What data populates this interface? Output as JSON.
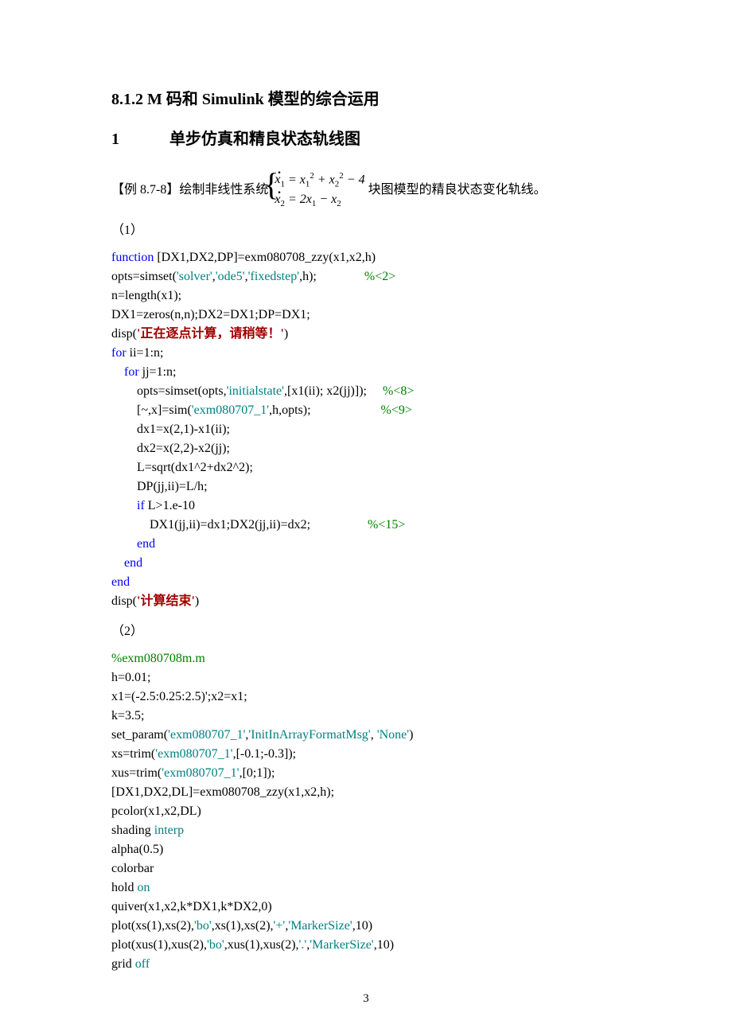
{
  "headings": {
    "section": "8.1.2  M 码和 Simulink 模型的综合运用",
    "sub_num": "1",
    "sub_title": "单步仿真和精良状态轨线图"
  },
  "example": {
    "label": "【例 8.7-8】",
    "pre": "绘制非线性系统",
    "post": "块图模型的精良状态变化轨线。"
  },
  "parts": {
    "p1": "（1）",
    "p2": "（2）"
  },
  "code1": [
    {
      "t": "function",
      "c": "blue"
    },
    {
      "t": " [DX1,DX2,DP]=exm080708_zzy(x1,x2,h)  ",
      "c": ""
    },
    {
      "nl": 1
    },
    {
      "t": "opts=simset(",
      "c": ""
    },
    {
      "t": "'solver'",
      "c": "teal"
    },
    {
      "t": ",",
      "c": ""
    },
    {
      "t": "'ode5'",
      "c": "teal"
    },
    {
      "t": ",",
      "c": ""
    },
    {
      "t": "'fixedstep'",
      "c": "teal"
    },
    {
      "t": ",h);               ",
      "c": ""
    },
    {
      "t": "%<2>",
      "c": "green"
    },
    {
      "nl": 1
    },
    {
      "t": "n=length(x1);",
      "c": ""
    },
    {
      "nl": 1
    },
    {
      "t": "DX1=zeros(n,n);DX2=DX1;DP=DX1;",
      "c": ""
    },
    {
      "nl": 1
    },
    {
      "t": "disp(",
      "c": ""
    },
    {
      "t": "'正在逐点计算，请稍等！'",
      "c": "red"
    },
    {
      "t": ")",
      "c": ""
    },
    {
      "nl": 1
    },
    {
      "t": "for",
      "c": "blue"
    },
    {
      "t": " ii=1:n;",
      "c": ""
    },
    {
      "nl": 1
    },
    {
      "t": "    ",
      "c": ""
    },
    {
      "t": "for",
      "c": "blue"
    },
    {
      "t": " jj=1:n;",
      "c": ""
    },
    {
      "nl": 1
    },
    {
      "t": "        opts=simset(opts,",
      "c": ""
    },
    {
      "t": "'initialstate'",
      "c": "teal"
    },
    {
      "t": ",[x1(ii); x2(jj)]);     ",
      "c": ""
    },
    {
      "t": "%<8>",
      "c": "green"
    },
    {
      "nl": 1
    },
    {
      "t": "        [~,x]=sim(",
      "c": ""
    },
    {
      "t": "'exm080707_1'",
      "c": "teal"
    },
    {
      "t": ",h,opts);                      ",
      "c": ""
    },
    {
      "t": "%<9>",
      "c": "green"
    },
    {
      "nl": 1
    },
    {
      "t": "        dx1=x(2,1)-x1(ii);",
      "c": ""
    },
    {
      "nl": 1
    },
    {
      "t": "        dx2=x(2,2)-x2(jj);",
      "c": ""
    },
    {
      "nl": 1
    },
    {
      "t": "        L=sqrt(dx1^2+dx2^2);",
      "c": ""
    },
    {
      "nl": 1
    },
    {
      "t": "        DP(jj,ii)=L/h;",
      "c": ""
    },
    {
      "nl": 1
    },
    {
      "t": "        ",
      "c": ""
    },
    {
      "t": "if",
      "c": "blue"
    },
    {
      "t": " L>1.e-10",
      "c": ""
    },
    {
      "nl": 1
    },
    {
      "t": "            DX1(jj,ii)=dx1;DX2(jj,ii)=dx2;                  ",
      "c": ""
    },
    {
      "t": "%<15>",
      "c": "green"
    },
    {
      "nl": 1
    },
    {
      "t": "        ",
      "c": ""
    },
    {
      "t": "end",
      "c": "blue"
    },
    {
      "nl": 1
    },
    {
      "t": "    ",
      "c": ""
    },
    {
      "t": "end",
      "c": "blue"
    },
    {
      "nl": 1
    },
    {
      "t": "end",
      "c": "blue"
    },
    {
      "nl": 1
    },
    {
      "t": "disp(",
      "c": ""
    },
    {
      "t": "'计算结束'",
      "c": "red"
    },
    {
      "t": ")",
      "c": ""
    },
    {
      "nl": 1
    }
  ],
  "code2": [
    {
      "t": "%exm080708m.m",
      "c": "green"
    },
    {
      "nl": 1
    },
    {
      "t": "h=0.01;",
      "c": ""
    },
    {
      "nl": 1
    },
    {
      "t": "x1=(-2.5:0.25:2.5)';x2=x1;",
      "c": ""
    },
    {
      "nl": 1
    },
    {
      "t": "k=3.5;",
      "c": ""
    },
    {
      "nl": 1
    },
    {
      "t": "set_param(",
      "c": ""
    },
    {
      "t": "'exm080707_1'",
      "c": "teal"
    },
    {
      "t": ",",
      "c": ""
    },
    {
      "t": "'InitInArrayFormatMsg'",
      "c": "teal"
    },
    {
      "t": ", ",
      "c": ""
    },
    {
      "t": "'None'",
      "c": "teal"
    },
    {
      "t": ")",
      "c": ""
    },
    {
      "nl": 1
    },
    {
      "t": "xs=trim(",
      "c": ""
    },
    {
      "t": "'exm080707_1'",
      "c": "teal"
    },
    {
      "t": ",[-0.1;-0.3]);",
      "c": ""
    },
    {
      "nl": 1
    },
    {
      "t": "xus=trim(",
      "c": ""
    },
    {
      "t": "'exm080707_1'",
      "c": "teal"
    },
    {
      "t": ",[0;1]);",
      "c": ""
    },
    {
      "nl": 1
    },
    {
      "t": "[DX1,DX2,DL]=exm080708_zzy(x1,x2,h);",
      "c": ""
    },
    {
      "nl": 1
    },
    {
      "t": "pcolor(x1,x2,DL)",
      "c": ""
    },
    {
      "nl": 1
    },
    {
      "t": "shading ",
      "c": ""
    },
    {
      "t": "interp",
      "c": "teal"
    },
    {
      "nl": 1
    },
    {
      "t": "alpha(0.5)",
      "c": ""
    },
    {
      "nl": 1
    },
    {
      "t": "colorbar",
      "c": ""
    },
    {
      "nl": 1
    },
    {
      "t": "hold ",
      "c": ""
    },
    {
      "t": "on",
      "c": "teal"
    },
    {
      "nl": 1
    },
    {
      "t": "quiver(x1,x2,k*DX1,k*DX2,0)",
      "c": ""
    },
    {
      "nl": 1
    },
    {
      "t": "plot(xs(1),xs(2),",
      "c": ""
    },
    {
      "t": "'bo'",
      "c": "teal"
    },
    {
      "t": ",xs(1),xs(2),",
      "c": ""
    },
    {
      "t": "'+'",
      "c": "teal"
    },
    {
      "t": ",",
      "c": ""
    },
    {
      "t": "'MarkerSize'",
      "c": "teal"
    },
    {
      "t": ",10)",
      "c": ""
    },
    {
      "nl": 1
    },
    {
      "t": "plot(xus(1),xus(2),",
      "c": ""
    },
    {
      "t": "'bo'",
      "c": "teal"
    },
    {
      "t": ",xus(1),xus(2),",
      "c": ""
    },
    {
      "t": "'.'",
      "c": "teal"
    },
    {
      "t": ",",
      "c": ""
    },
    {
      "t": "'MarkerSize'",
      "c": "teal"
    },
    {
      "t": ",10)",
      "c": ""
    },
    {
      "nl": 1
    },
    {
      "t": "grid ",
      "c": ""
    },
    {
      "t": "off",
      "c": "teal"
    },
    {
      "nl": 1
    }
  ],
  "pagenum": "3"
}
